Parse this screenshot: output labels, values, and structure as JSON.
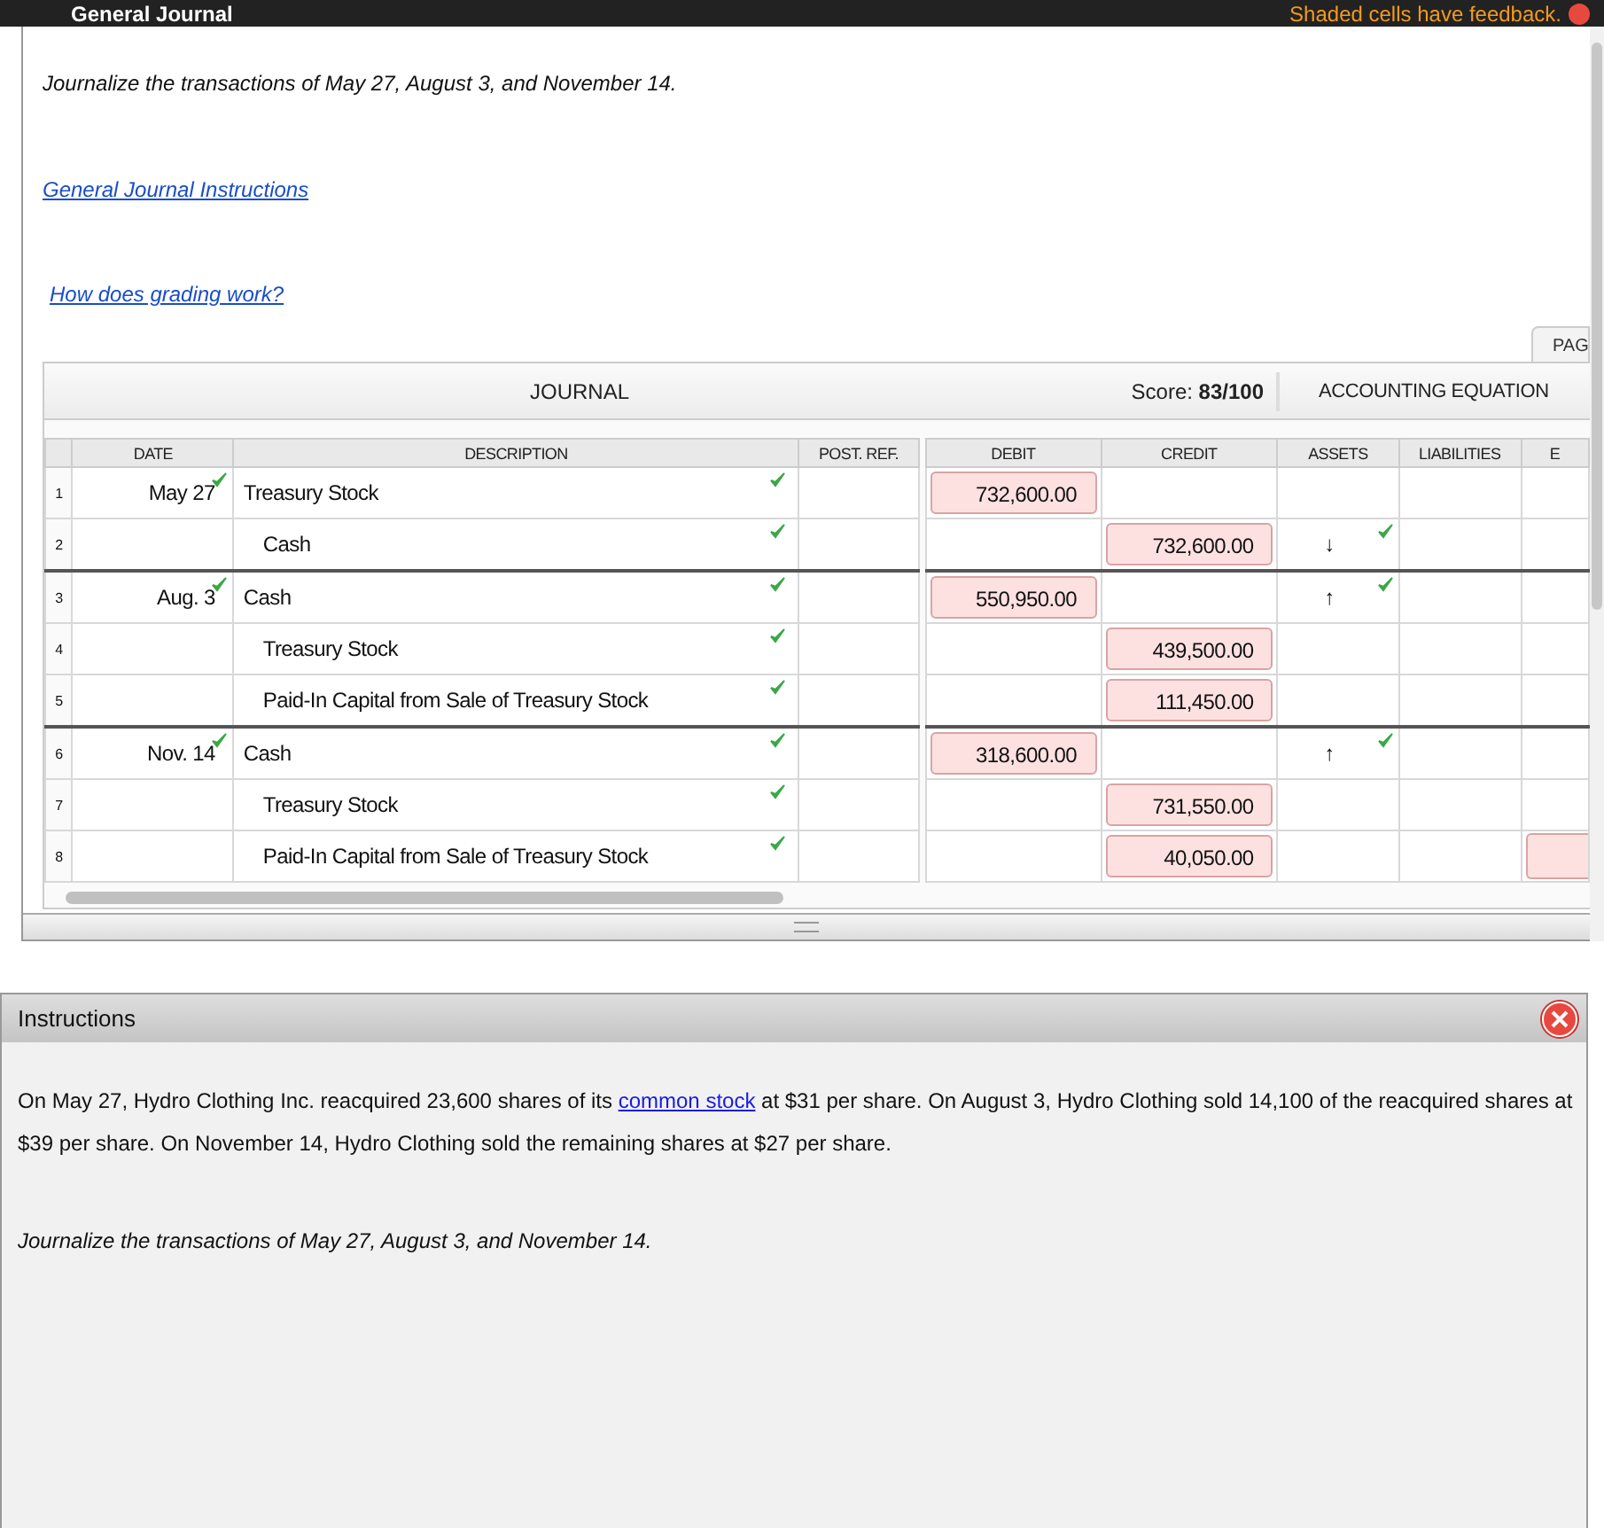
{
  "top_bar": {
    "title": "General Journal",
    "feedback_note": "Shaded cells have feedback."
  },
  "prompt": "Journalize the transactions of May 27, August 3, and November 14.",
  "instructions_link": "General Journal Instructions",
  "grading_link": "How does grading work?",
  "page_tab": "PAG",
  "journal": {
    "title": "JOURNAL",
    "score": "Score: **83/100**",
    "equation_title": "ACCOUNTING EQUATION",
    "columns": [
      "DATE",
      "DESCRIPTION",
      "POST. REF.",
      "DEBIT",
      "CREDIT",
      "ASSETS",
      "LIABILITIES",
      "E"
    ],
    "rows": [
      {
        "number": "1",
        "date": "May 27",
        "date_correct": true,
        "description": "Treasury Stock",
        "indented": false,
        "description_correct": true,
        "debit": "732,600.00",
        "debit_shaded": true,
        "credit": "",
        "credit_shaded": false,
        "assets": "",
        "assets_correct": false,
        "equity_shaded": false,
        "new_entry": false
      },
      {
        "number": "2",
        "date": "",
        "date_correct": false,
        "description": "Cash",
        "indented": true,
        "description_correct": true,
        "debit": "",
        "debit_shaded": false,
        "credit": "732,600.00",
        "credit_shaded": true,
        "assets": "↓",
        "assets_correct": true,
        "equity_shaded": false,
        "new_entry": false
      },
      {
        "number": "3",
        "date": "Aug. 3",
        "date_correct": true,
        "description": "Cash",
        "indented": false,
        "description_correct": true,
        "debit": "550,950.00",
        "debit_shaded": true,
        "credit": "",
        "credit_shaded": false,
        "assets": "↑",
        "assets_correct": true,
        "equity_shaded": false,
        "new_entry": true
      },
      {
        "number": "4",
        "date": "",
        "date_correct": false,
        "description": "Treasury Stock",
        "indented": true,
        "description_correct": true,
        "debit": "",
        "debit_shaded": false,
        "credit": "439,500.00",
        "credit_shaded": true,
        "assets": "",
        "assets_correct": false,
        "equity_shaded": false,
        "new_entry": false
      },
      {
        "number": "5",
        "date": "",
        "date_correct": false,
        "description": "Paid-In Capital from Sale of Treasury Stock",
        "indented": true,
        "description_correct": true,
        "debit": "",
        "debit_shaded": false,
        "credit": "111,450.00",
        "credit_shaded": true,
        "assets": "",
        "assets_correct": false,
        "equity_shaded": false,
        "new_entry": false
      },
      {
        "number": "6",
        "date": "Nov. 14",
        "date_correct": true,
        "description": "Cash",
        "indented": false,
        "description_correct": true,
        "debit": "318,600.00",
        "debit_shaded": true,
        "credit": "",
        "credit_shaded": false,
        "assets": "↑",
        "assets_correct": true,
        "equity_shaded": false,
        "new_entry": true
      },
      {
        "number": "7",
        "date": "",
        "date_correct": false,
        "description": "Treasury Stock",
        "indented": true,
        "description_correct": true,
        "debit": "",
        "debit_shaded": false,
        "credit": "731,550.00",
        "credit_shaded": true,
        "assets": "",
        "assets_correct": false,
        "equity_shaded": false,
        "new_entry": false
      },
      {
        "number": "8",
        "date": "",
        "date_correct": false,
        "description": "Paid-In Capital from Sale of Treasury Stock",
        "indented": true,
        "description_correct": true,
        "debit": "",
        "debit_shaded": false,
        "credit": "40,050.00",
        "credit_shaded": true,
        "assets": "",
        "assets_correct": false,
        "equity_shaded": true,
        "new_entry": false
      }
    ]
  },
  "instructions": {
    "title": "Instructions",
    "text": "On May 27, Hydro Clothing Inc. reacquired 23,600 shares of its ",
    "link": "common stock",
    "text_after": " at $31 per share. On August 3, Hydro Clothing sold 14,100 of the reacquired shares at $39 per share. On November 14, Hydro Clothing sold the remaining shares at $27 per share.",
    "prompt": "Journalize the transactions of May 27, August 3, and November 14."
  }
}
